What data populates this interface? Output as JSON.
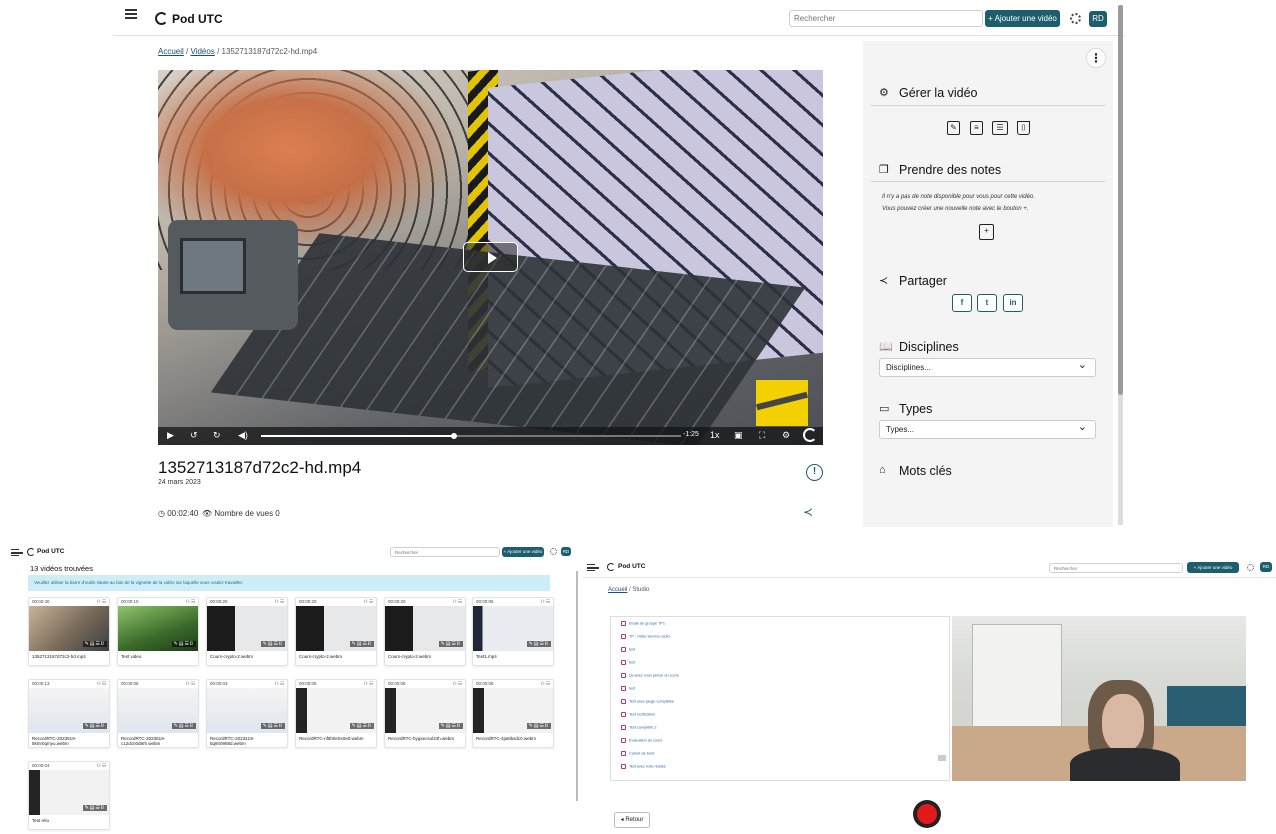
{
  "app": {
    "brand": "Pod UTC",
    "search_placeholder": "Rechercher",
    "add_video_label": "+ Ajouter une vidéo",
    "avatar_initials": "RD"
  },
  "video_page": {
    "breadcrumb": {
      "home": "Accueil",
      "section": "Vidéos",
      "current": "1352713187d72c2-hd.mp4",
      "sep1": "/",
      "sep2": "/"
    },
    "player": {
      "time_remaining": "-1:25",
      "speed": "1x",
      "progress_fraction": 0.46
    },
    "title": "1352713187d72c2-hd.mp4",
    "date": "24 mars 2023",
    "duration": "00:02:40",
    "views_label": "Nombre de vues 0",
    "report_icon": "!"
  },
  "aside": {
    "kebab": "⋮",
    "manage": {
      "title": "Gérer la vidéo"
    },
    "notes": {
      "title": "Prendre des notes",
      "line1": "Il n'y a pas de note disponible pour vous pour cette vidéo.",
      "line2": "Vous pouvez créer une nouvelle note avec le bouton +."
    },
    "share": {
      "title": "Partager",
      "facebook": "f",
      "twitter": "t",
      "linkedin": "in"
    },
    "disciplines": {
      "title": "Disciplines",
      "select": "Disciplines..."
    },
    "types": {
      "title": "Types",
      "select": "Types..."
    },
    "keywords": {
      "title": "Mots clés"
    }
  },
  "video_list": {
    "count_label": "13 vidéos trouvées",
    "notice": "Veuillez utiliser la barre d'outils située au bas de la vignette de la vidéo sur laquelle vous voulez travailler.",
    "cards": [
      {
        "duration": "00:02:40",
        "title": "1352713187d72c2-hd.mp4"
      },
      {
        "duration": "00:00:10",
        "title": "Test video"
      },
      {
        "duration": "00:00:20",
        "title": "Cours-crypto-2.webm"
      },
      {
        "duration": "00:00:20",
        "title": "Cours-crypto-2.webm"
      },
      {
        "duration": "00:00:20",
        "title": "Cours-crypto-2.webm"
      },
      {
        "duration": "00:00:05",
        "title": "Test1.mp4"
      },
      {
        "duration": "00:00:13",
        "title": "RecordRTC-2023619-5ktnr0qmyu.webm"
      },
      {
        "duration": "00:00:08",
        "title": "RecordRTC-2023619-c12dcn0d8rh.webm"
      },
      {
        "duration": "00:00:03",
        "title": "RecordRTC-2023419-5q9n0988d.webm"
      },
      {
        "duration": "00:00:06",
        "title": "RecordRTC-nf5h0e0x0e0.webm"
      },
      {
        "duration": "00:00:06",
        "title": "RecordRTC-bygxecsol33h.webm"
      },
      {
        "duration": "00:00:06",
        "title": "RecordRTC-4ja8ibsdc0.webm"
      },
      {
        "duration": "00:00:04",
        "title": "Test réio"
      }
    ]
  },
  "studio": {
    "breadcrumb": {
      "home": "Accueil",
      "current": "Studio",
      "sep": "/"
    },
    "course_lines": [
      "Etude de groupe TP1",
      "TP - Visite Service radio",
      "test",
      "test",
      "Qu'avez vous pensé du cours",
      "test",
      "Test avec jauge complétée",
      "Test Inclfication",
      "Test complétin 2",
      "Évaluation du cours",
      "Carnet de bord",
      "Test avec note réalisé"
    ],
    "back_label": "◂ Retour"
  }
}
